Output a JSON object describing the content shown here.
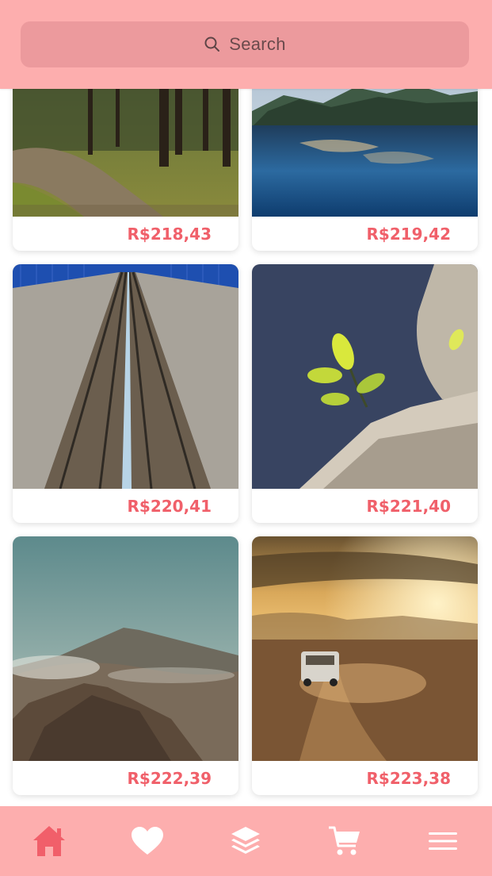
{
  "header": {
    "search_label": "Search",
    "search_icon": "search-icon"
  },
  "products": [
    {
      "price": "R$218,43",
      "image": "forest-path-photo"
    },
    {
      "price": "R$219,42",
      "image": "mountain-lake-photo"
    },
    {
      "price": "R$220,41",
      "image": "railway-tracks-photo"
    },
    {
      "price": "R$221,40",
      "image": "plant-on-rock-photo"
    },
    {
      "price": "R$222,39",
      "image": "volcano-landscape-photo"
    },
    {
      "price": "R$223,38",
      "image": "van-desert-sunset-photo"
    }
  ],
  "tabbar": {
    "items": [
      {
        "icon": "home-icon",
        "active": true
      },
      {
        "icon": "heart-icon",
        "active": false
      },
      {
        "icon": "layers-icon",
        "active": false
      },
      {
        "icon": "cart-icon",
        "active": false
      },
      {
        "icon": "menu-icon",
        "active": false
      }
    ]
  },
  "colors": {
    "bar_background": "#fdaeae",
    "search_background": "#ec9a9d",
    "price": "#f0606a",
    "active_tab": "#f15f6a",
    "inactive_tab": "#ffffff"
  }
}
